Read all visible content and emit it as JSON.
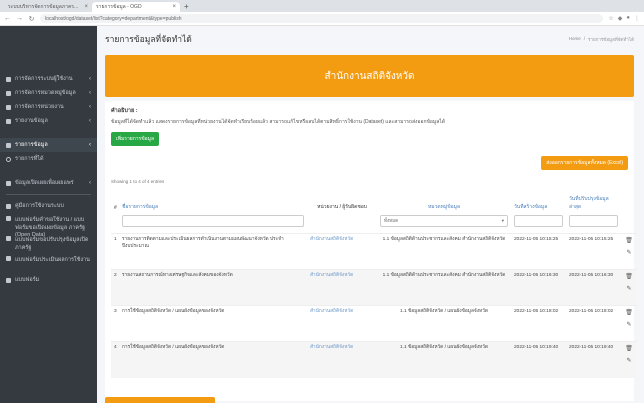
{
  "browser": {
    "tabs": [
      {
        "title": "ระบบบริหารจัดการข้อมูลภาคร...",
        "active": false
      },
      {
        "title": "รายการข้อมูล - OGD",
        "active": true
      }
    ],
    "url": "localhost/ogd/dataset/list?category=department&type=publish",
    "new_tab": "+"
  },
  "sidebar": {
    "items": [
      {
        "label": "การจัดการระบบผู้ใช้งาน",
        "chevron": "‹",
        "icon": "users-icon"
      },
      {
        "label": "การจัดการหมวดหมู่ข้อมูล",
        "chevron": "‹",
        "icon": "folder-icon"
      },
      {
        "label": "การจัดการหน่วยงาน",
        "chevron": "‹",
        "icon": "building-icon"
      },
      {
        "label": "รายงานข้อมูล",
        "chevron": "‹",
        "icon": "report-icon"
      }
    ],
    "active": {
      "label": "รายการข้อมูล",
      "chevron": "‹"
    },
    "sub": {
      "label": "รายการที่ได้"
    },
    "items2": [
      {
        "label": "ข้อมูลเปิดเผยเพื่อเผยแพร่",
        "chevron": "‹"
      }
    ],
    "items3": [
      {
        "label": "คู่มือการใช้งานระบบ"
      },
      {
        "label": "แบบฟอร์มคำขอใช้งาน / แบบฟอร์มขอเปิดเผยข้อมูล ภาครัฐ (Open Data)"
      },
      {
        "label": "แบบฟอร์มขอปรับปรุงข้อมูลเปิด ภาครัฐ"
      },
      {
        "label": "แบบฟอร์มประเมินผลการใช้งาน"
      },
      {
        "label": "แบบฟอร์ม"
      }
    ]
  },
  "header": {
    "title": "รายการข้อมูลที่จัดทำได้",
    "breadcrumb": [
      "Home",
      "รายการข้อมูลที่จัดทำได้"
    ]
  },
  "banner": {
    "text": "สำนักงานสถิติจังหวัด"
  },
  "content": {
    "desc_heading": "คำอธิบาย :",
    "desc_text": "ข้อมูลที่ได้จัดทำแล้ว แสดงรายการข้อมูลที่หน่วยงานได้จัดทำเรียบร้อยแล้ว สามารถแก้ไขหรือลบได้ตามสิทธิ์การใช้งาน (Dataset) และสามารถส่งออกข้อมูลได้",
    "add_button": "เพิ่มรายการข้อมูล",
    "export_button": "ส่งออกรายการข้อมูลทั้งหมด (Excel)",
    "showing": "Showing 1 to 4 of 4 entries"
  },
  "table": {
    "columns": [
      {
        "label": "#",
        "style": "dark"
      },
      {
        "label": "ชื่อรายการข้อมูล",
        "style": "link"
      },
      {
        "label": "หน่วยงาน / ผู้รับผิดชอบ",
        "style": "dark"
      },
      {
        "label": "หมวดหมู่ข้อมูล",
        "style": "link"
      },
      {
        "label": "วันที่สร้างข้อมูล",
        "style": "link"
      },
      {
        "label": "วันที่ปรับปรุงข้อมูลล่าสุด",
        "style": "link"
      },
      {
        "label": "",
        "style": "dark"
      }
    ],
    "filter_select": "ทั้งหมด",
    "rows": [
      {
        "num": "1",
        "name": "รายงานการติดตามและประเมินผลการดำเนินงานตามแผนพัฒนาจังหวัด ประจำปีงบประมาณ",
        "dept": "สำนักงานสถิติจังหวัด",
        "cat": "1.1 ข้อมูลสถิติด้านประชากรและสังคม สำนักงานสถิติจังหวัด",
        "created": "2022-11-05 10:15:25",
        "updated": "2022-11-05 10:15:25",
        "alt": false
      },
      {
        "num": "2",
        "name": "รายงานสถานการณ์ทางเศรษฐกิจและสังคมของจังหวัด",
        "dept": "สำนักงานสถิติจังหวัด",
        "cat": "1.1 ข้อมูลสถิติด้านประชากรและสังคม สำนักงานสถิติจังหวัด",
        "created": "2022-11-05 10:16:30",
        "updated": "2022-11-05 10:16:30",
        "alt": true
      },
      {
        "num": "3",
        "name": "การใช้ข้อมูลสถิติจังหวัด / แผนผังข้อมูลของจังหวัด",
        "dept": "สำนักงานสถิติจังหวัด",
        "cat": "1.1 ข้อมูลสถิติจังหวัด / แผนผังข้อมูลจังหวัด",
        "created": "2022-11-05 10:18:02",
        "updated": "2022-11-05 10:18:02",
        "alt": false
      },
      {
        "num": "4",
        "name": "การใช้ข้อมูลสถิติจังหวัด / แผนผังข้อมูลของจังหวัด",
        "dept": "สำนักงานสถิติจังหวัด",
        "cat": "1.1 ข้อมูลสถิติจังหวัด / แผนผังข้อมูลจังหวัด",
        "created": "2022-11-05 10:19:40",
        "updated": "2022-11-05 10:19:40",
        "alt": true
      }
    ]
  },
  "colors": {
    "accent": "#f39c12",
    "success": "#28a745",
    "sidebar": "#343a40",
    "link": "#4a7fb8"
  }
}
